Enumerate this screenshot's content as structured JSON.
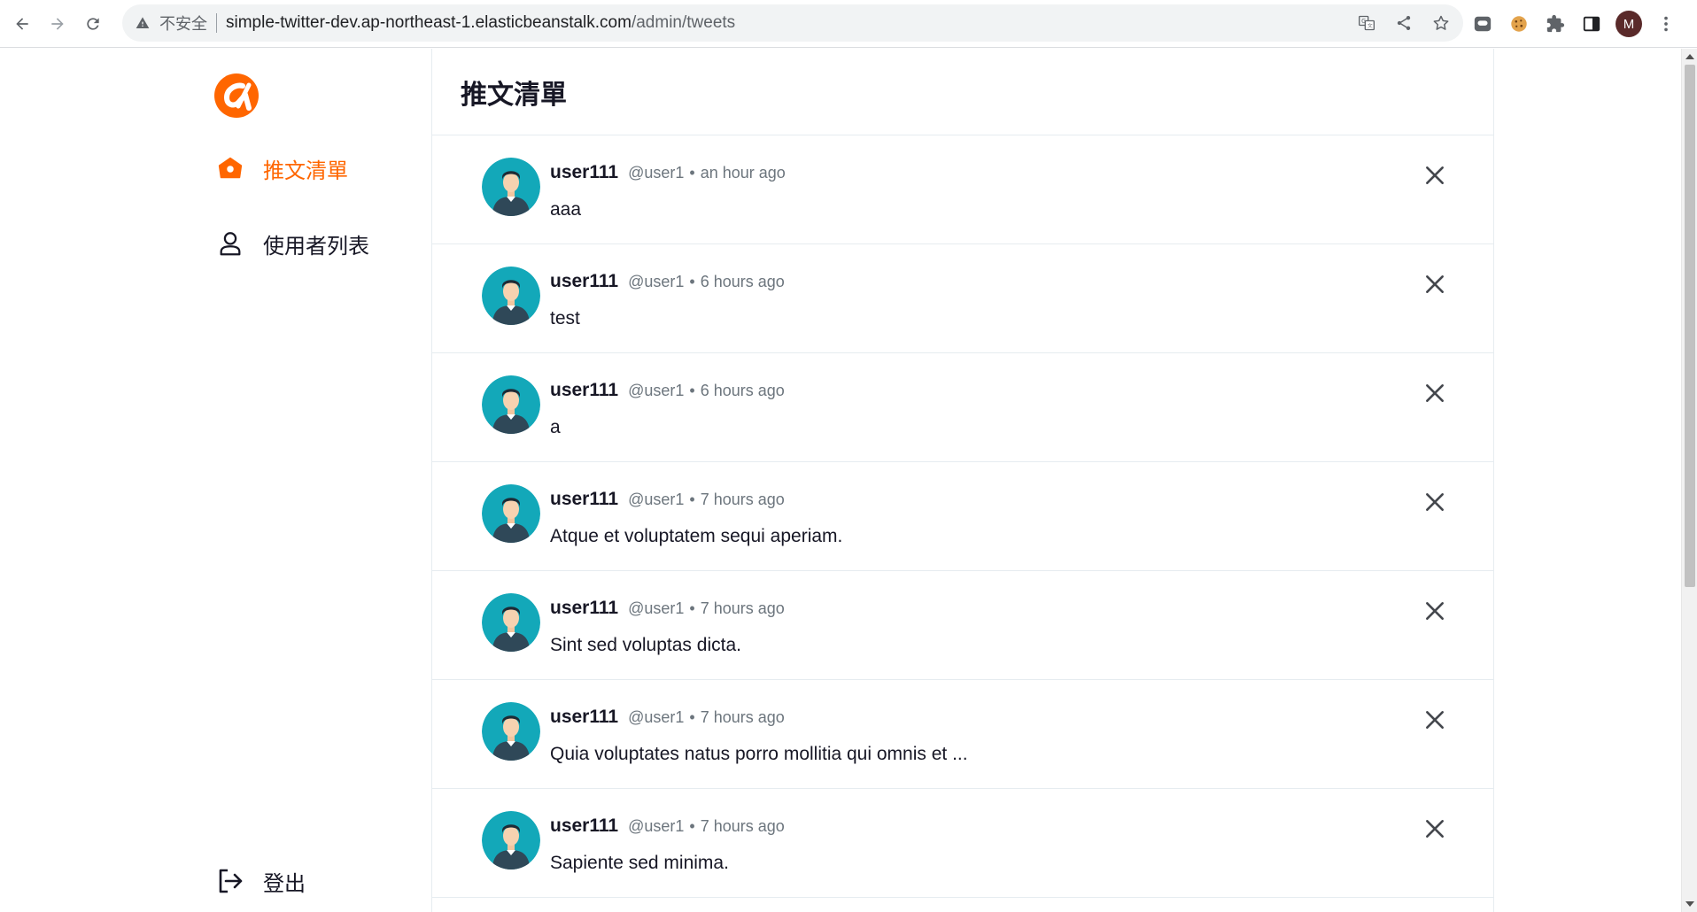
{
  "browser": {
    "security_label": "不安全",
    "url_host": "simple-twitter-dev.ap-northeast-1.elasticbeanstalk.com",
    "url_path": "/admin/tweets",
    "profile_initial": "M"
  },
  "colors": {
    "brand": "#FF6600",
    "avatar_bg": "#13A8B9"
  },
  "sidebar": {
    "items": [
      {
        "label": "推文清單",
        "icon": "home-icon",
        "active": true
      },
      {
        "label": "使用者列表",
        "icon": "user-icon",
        "active": false
      }
    ],
    "logout_label": "登出"
  },
  "main": {
    "title": "推文清單",
    "tweets": [
      {
        "name": "user111",
        "account": "@user1",
        "time": "an hour ago",
        "content": "aaa"
      },
      {
        "name": "user111",
        "account": "@user1",
        "time": "6 hours ago",
        "content": "test"
      },
      {
        "name": "user111",
        "account": "@user1",
        "time": "6 hours ago",
        "content": "a"
      },
      {
        "name": "user111",
        "account": "@user1",
        "time": "7 hours ago",
        "content": "Atque et voluptatem sequi aperiam."
      },
      {
        "name": "user111",
        "account": "@user1",
        "time": "7 hours ago",
        "content": "Sint sed voluptas dicta."
      },
      {
        "name": "user111",
        "account": "@user1",
        "time": "7 hours ago",
        "content": "Quia voluptates natus porro mollitia qui omnis et ..."
      },
      {
        "name": "user111",
        "account": "@user1",
        "time": "7 hours ago",
        "content": "Sapiente sed minima."
      }
    ],
    "dot_separator": "•"
  }
}
